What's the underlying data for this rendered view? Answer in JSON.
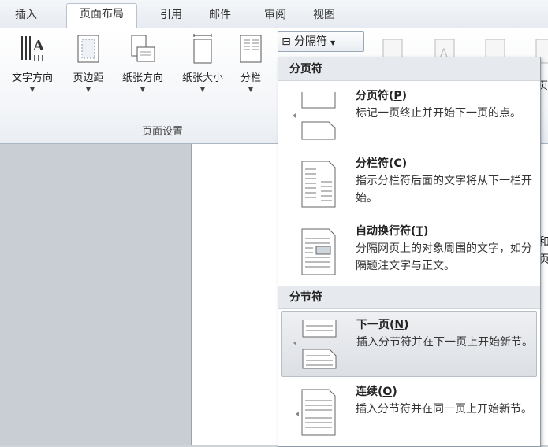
{
  "tabs": [
    {
      "label": "插入"
    },
    {
      "label": "页面布局"
    },
    {
      "label": "引用"
    },
    {
      "label": "邮件"
    },
    {
      "label": "审阅"
    },
    {
      "label": "视图"
    }
  ],
  "ribbon": {
    "buttons": [
      {
        "label": "文字方向",
        "icon": "text-direction-icon"
      },
      {
        "label": "页边距",
        "icon": "margins-icon"
      },
      {
        "label": "纸张方向",
        "icon": "orientation-icon"
      },
      {
        "label": "纸张大小",
        "icon": "paper-size-icon"
      },
      {
        "label": "分栏",
        "icon": "columns-icon"
      }
    ],
    "group_label": "页面设置",
    "breaks_button_label": "分隔符",
    "partial_right_label": "页"
  },
  "page_text": {
    "line1": "和",
    "line2": "页"
  },
  "menu": {
    "section1": "分页符",
    "section2": "分节符",
    "items": [
      {
        "title": "分页符",
        "key": "P",
        "desc": "标记一页终止并开始下一页的点。",
        "icon": "page-break-icon"
      },
      {
        "title": "分栏符",
        "key": "C",
        "desc": "指示分栏符后面的文字将从下一栏开始。",
        "icon": "column-break-icon"
      },
      {
        "title": "自动换行符",
        "key": "T",
        "desc": "分隔网页上的对象周围的文字，如分隔题注文字与正文。",
        "icon": "text-wrapping-break-icon"
      },
      {
        "title": "下一页",
        "key": "N",
        "desc": "插入分节符并在下一页上开始新节。",
        "icon": "next-page-section-icon"
      },
      {
        "title": "连续",
        "key": "O",
        "desc": "插入分节符并在同一页上开始新节。",
        "icon": "continuous-section-icon"
      }
    ]
  }
}
